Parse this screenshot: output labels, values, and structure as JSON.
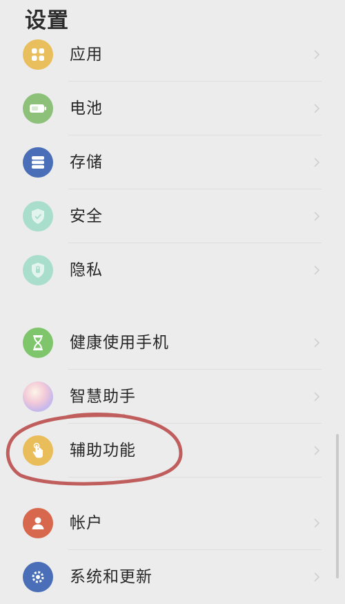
{
  "header": {
    "title": "设置"
  },
  "items": [
    {
      "label": "应用",
      "icon": "apps-grid-icon",
      "color": "#e8bf5c"
    },
    {
      "label": "电池",
      "icon": "battery-icon",
      "color": "#8dc17a"
    },
    {
      "label": "存储",
      "icon": "storage-icon",
      "color": "#4a6fb8"
    },
    {
      "label": "安全",
      "icon": "shield-check-icon",
      "color": "#a9ddcc"
    },
    {
      "label": "隐私",
      "icon": "privacy-shield-icon",
      "color": "#a9ddcc"
    },
    {
      "label": "健康使用手机",
      "icon": "hourglass-icon",
      "color": "#7fc56c"
    },
    {
      "label": "智慧助手",
      "icon": "assistant-orb-icon",
      "color": "#e6c6d7"
    },
    {
      "label": "辅助功能",
      "icon": "hand-tap-icon",
      "color": "#e9bd5a"
    },
    {
      "label": "帐户",
      "icon": "account-icon",
      "color": "#d7674d"
    },
    {
      "label": "系统和更新",
      "icon": "system-gear-icon",
      "color": "#4a6fb8"
    }
  ],
  "annotation": {
    "color": "#b94545"
  }
}
